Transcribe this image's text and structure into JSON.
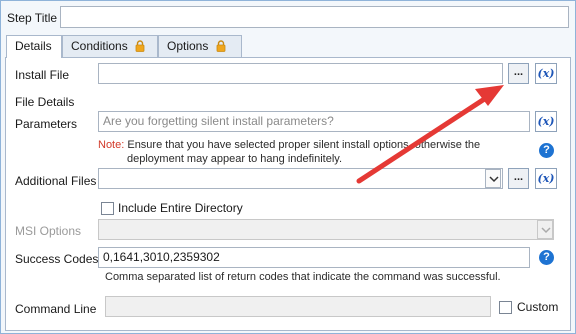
{
  "step_title": {
    "label": "Step Title",
    "value": ""
  },
  "tabs": [
    {
      "label": "Details",
      "active": true,
      "locked": false
    },
    {
      "label": "Conditions",
      "active": false,
      "locked": true
    },
    {
      "label": "Options",
      "active": false,
      "locked": true
    }
  ],
  "install_file": {
    "label": "Install File",
    "value": "",
    "browse": "...",
    "variable": "(x)"
  },
  "file_details": {
    "label": "File Details"
  },
  "parameters": {
    "label": "Parameters",
    "placeholder": "Are you forgetting silent install parameters?",
    "variable": "(x)",
    "note_prefix": "Note:",
    "note_line1": " Ensure that you have selected proper silent install options, otherwise the",
    "note_line2": "deployment may appear to hang indefinitely."
  },
  "additional_files": {
    "label": "Additional Files",
    "value": "",
    "browse": "...",
    "variable": "(x)"
  },
  "include_entire_directory": {
    "label": "Include Entire Directory",
    "checked": false
  },
  "msi_options": {
    "label": "MSI Options",
    "value": "",
    "disabled": true
  },
  "success_codes": {
    "label": "Success Codes",
    "value": "0,1641,3010,2359302",
    "hint": "Comma separated list of return codes that indicate the command was successful."
  },
  "command_line": {
    "label": "Command Line",
    "value": "",
    "custom_label": "Custom",
    "custom_checked": false
  },
  "help_glyph": "?",
  "colors": {
    "accent": "#1e73d2",
    "annotation_arrow": "#e53935",
    "note_red": "#d23a2a"
  }
}
